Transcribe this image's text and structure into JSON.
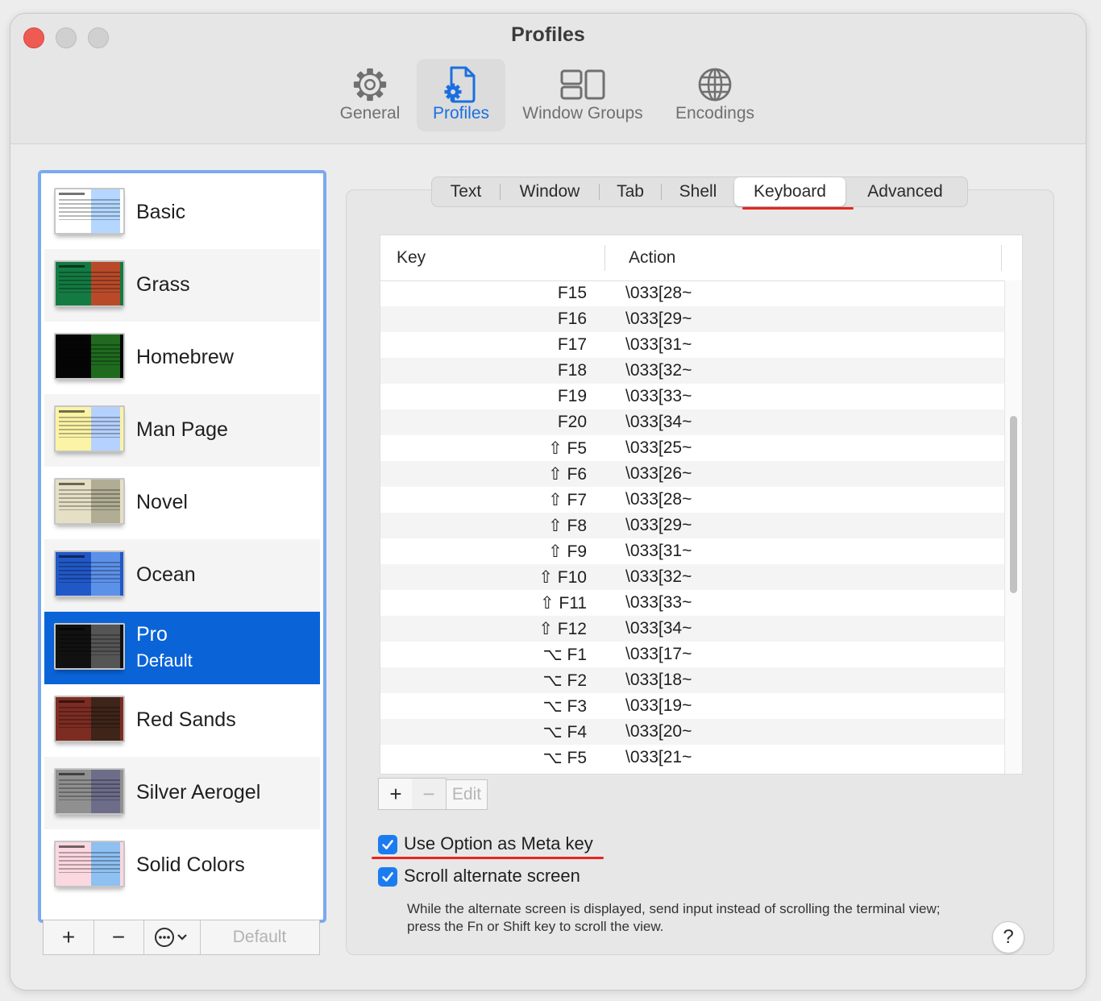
{
  "window": {
    "title": "Profiles"
  },
  "toolbar": {
    "items": [
      {
        "label": "General",
        "icon": "gear-icon"
      },
      {
        "label": "Profiles",
        "icon": "profile-document-icon",
        "active": true
      },
      {
        "label": "Window Groups",
        "icon": "window-groups-icon"
      },
      {
        "label": "Encodings",
        "icon": "globe-icon"
      }
    ]
  },
  "profiles": [
    {
      "name": "Basic",
      "sub": "",
      "thumb_bg": "#ffffff",
      "thumb_accent": "#b5d7ff"
    },
    {
      "name": "Grass",
      "sub": "",
      "thumb_bg": "#137a42",
      "thumb_accent": "#b84a2a"
    },
    {
      "name": "Homebrew",
      "sub": "",
      "thumb_bg": "#050505",
      "thumb_accent": "#1f6a1f"
    },
    {
      "name": "Man Page",
      "sub": "",
      "thumb_bg": "#fbf3a5",
      "thumb_accent": "#b5d1ff"
    },
    {
      "name": "Novel",
      "sub": "",
      "thumb_bg": "#e5dfc6",
      "thumb_accent": "#b0ad94"
    },
    {
      "name": "Ocean",
      "sub": "",
      "thumb_bg": "#2158c8",
      "thumb_accent": "#5c91ea"
    },
    {
      "name": "Pro",
      "sub": "Default",
      "thumb_bg": "#111111",
      "thumb_accent": "#555555",
      "selected": true
    },
    {
      "name": "Red Sands",
      "sub": "",
      "thumb_bg": "#7d2c22",
      "thumb_accent": "#3e2419"
    },
    {
      "name": "Silver Aerogel",
      "sub": "",
      "thumb_bg": "#909090",
      "thumb_accent": "#6d6d8a"
    },
    {
      "name": "Solid Colors",
      "sub": "",
      "thumb_bg": "#fbd7df",
      "thumb_accent": "#8ec0f2"
    }
  ],
  "list_tools": {
    "add": "+",
    "remove": "−",
    "more": "⋯",
    "default_label": "Default"
  },
  "tabs": [
    "Text",
    "Window",
    "Tab",
    "Shell",
    "Keyboard",
    "Advanced"
  ],
  "active_tab": "Keyboard",
  "table": {
    "headers": [
      "Key",
      "Action"
    ],
    "rows": [
      {
        "key": "F15",
        "action": "\\033[28~"
      },
      {
        "key": "F16",
        "action": "\\033[29~"
      },
      {
        "key": "F17",
        "action": "\\033[31~"
      },
      {
        "key": "F18",
        "action": "\\033[32~"
      },
      {
        "key": "F19",
        "action": "\\033[33~"
      },
      {
        "key": "F20",
        "action": "\\033[34~"
      },
      {
        "key": "⇧ F5",
        "action": "\\033[25~"
      },
      {
        "key": "⇧ F6",
        "action": "\\033[26~"
      },
      {
        "key": "⇧ F7",
        "action": "\\033[28~"
      },
      {
        "key": "⇧ F8",
        "action": "\\033[29~"
      },
      {
        "key": "⇧ F9",
        "action": "\\033[31~"
      },
      {
        "key": "⇧ F10",
        "action": "\\033[32~"
      },
      {
        "key": "⇧ F11",
        "action": "\\033[33~"
      },
      {
        "key": "⇧ F12",
        "action": "\\033[34~"
      },
      {
        "key": "⌥ F1",
        "action": "\\033[17~"
      },
      {
        "key": "⌥ F2",
        "action": "\\033[18~"
      },
      {
        "key": "⌥ F3",
        "action": "\\033[19~"
      },
      {
        "key": "⌥ F4",
        "action": "\\033[20~"
      },
      {
        "key": "⌥ F5",
        "action": "\\033[21~"
      }
    ]
  },
  "table_tools": {
    "add": "+",
    "remove": "−",
    "edit": "Edit"
  },
  "options": {
    "use_option_as_meta": {
      "label": "Use Option as Meta key",
      "checked": true
    },
    "scroll_alternate": {
      "label": "Scroll alternate screen",
      "checked": true
    },
    "description": "While the alternate screen is displayed, send input instead of scrolling the terminal view; press the Fn or Shift key to scroll the view."
  },
  "help": "?",
  "colors": {
    "accent": "#0a64d8",
    "checkbox": "#1b7cf0",
    "annotation_red": "#e8261d",
    "list_focus_ring": "#7ba9ef"
  }
}
